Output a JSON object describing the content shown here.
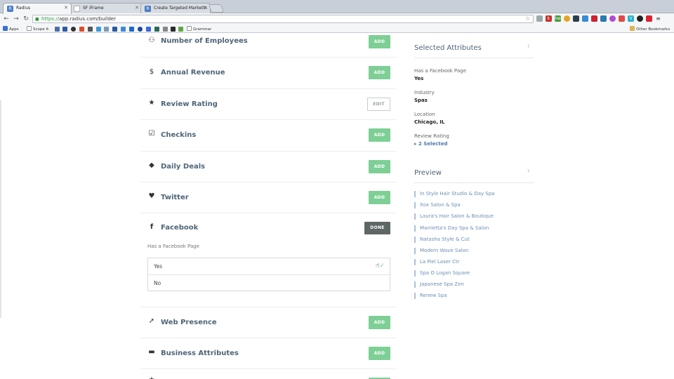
{
  "browser": {
    "tabs": [
      {
        "title": "Radius",
        "favicon": "R"
      },
      {
        "title": "SF iFrame",
        "favicon": ""
      },
      {
        "title": "Create Targeted Marketin",
        "favicon": "R"
      }
    ],
    "url": {
      "scheme": "https://",
      "host": "app.radius.com/builder"
    },
    "bookmarks": [
      {
        "label": "Apps"
      },
      {
        "label": "Scope It"
      },
      {
        "label": "Grammar"
      },
      {
        "label": "Other Bookmarks"
      }
    ]
  },
  "builder": {
    "attributes": [
      {
        "label": "Number of Employees",
        "icon": "people-icon",
        "action": "ADD"
      },
      {
        "label": "Annual Revenue",
        "icon": "dollar-icon",
        "action": "ADD"
      },
      {
        "label": "Review Rating",
        "icon": "star-icon",
        "action": "EDIT"
      },
      {
        "label": "Checkins",
        "icon": "checkbox-icon",
        "action": "ADD"
      },
      {
        "label": "Daily Deals",
        "icon": "tag-icon",
        "action": "ADD"
      },
      {
        "label": "Twitter",
        "icon": "twitter-icon",
        "action": "ADD"
      },
      {
        "label": "Facebook",
        "icon": "facebook-icon",
        "action": "DONE"
      },
      {
        "label": "Web Presence",
        "icon": "cursor-icon",
        "action": "ADD"
      },
      {
        "label": "Business Attributes",
        "icon": "briefcase-icon",
        "action": "ADD"
      }
    ],
    "facebook": {
      "sub_label": "Has a Facebook Page",
      "options": [
        {
          "label": "Yes",
          "selected": true
        },
        {
          "label": "No",
          "selected": false
        }
      ]
    }
  },
  "selected_attributes": {
    "title": "Selected Attributes",
    "help": "?",
    "items": [
      {
        "key": "Has a Facebook Page",
        "value": "Yes"
      },
      {
        "key": "Industry",
        "value": "Spas"
      },
      {
        "key": "Location",
        "value": "Chicago, IL"
      },
      {
        "key": "Review Rating",
        "value": "▸ 2 Selected"
      }
    ]
  },
  "preview": {
    "title": "Preview",
    "help": "?",
    "items": [
      "In Style Hair Studio & Day Spa",
      "Xox Salon & Spa",
      "Laura's Hair Salon & Boutique",
      "Marrietta's Day Spa & Salon",
      "Natasha Style & Cut",
      "Modern Wave Salon",
      "La Piel Laser Ctr",
      "Spa O Logan Square",
      "Japanese Spa Zen",
      "Renew Spa"
    ]
  },
  "colors": {
    "accent_green": "#7ecf95",
    "done_dark": "#5f6666",
    "label_blue": "#4e6579",
    "link_blue": "#6b8fb5"
  }
}
